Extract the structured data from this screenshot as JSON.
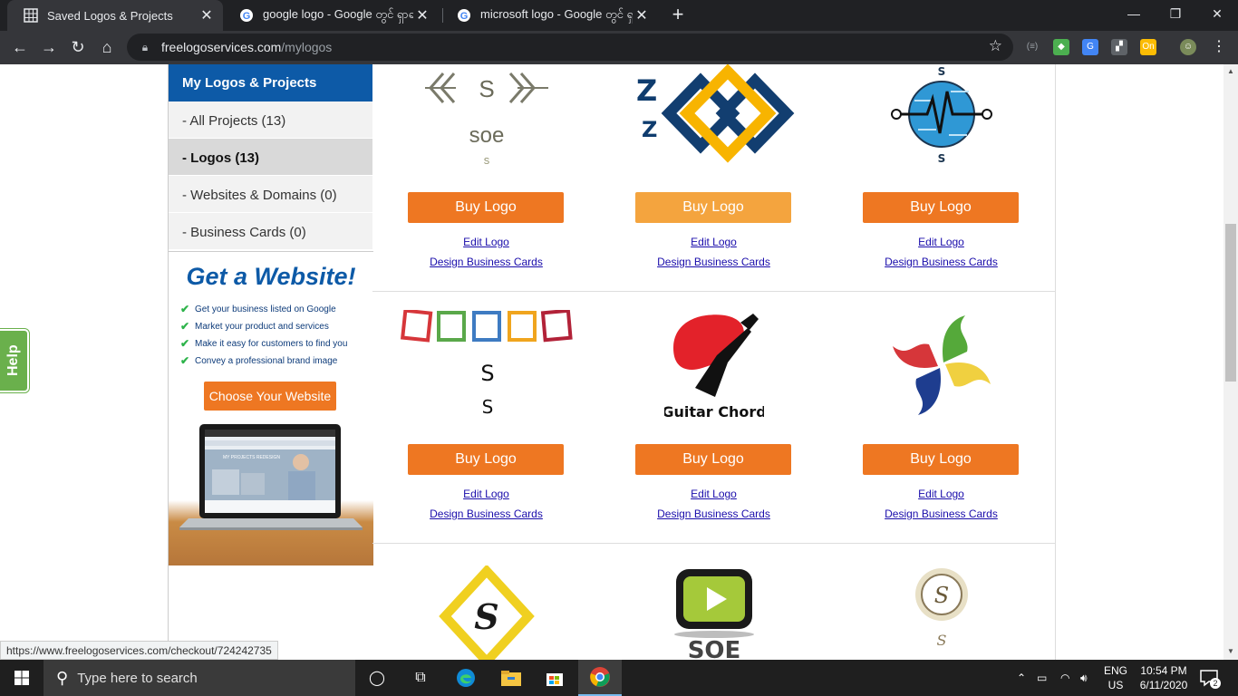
{
  "browser": {
    "tabs": [
      {
        "title": "Saved Logos & Projects",
        "active": true
      },
      {
        "title": "google logo - Google တွင် ရှာရန်",
        "active": false
      },
      {
        "title": "microsoft logo - Google တွင် ရှာရ",
        "active": false
      }
    ],
    "url_host": "freelogoservices.com",
    "url_path": "/mylogos",
    "status_url": "https://www.freelogoservices.com/checkout/724242735"
  },
  "sidebar": {
    "header": "My Logos & Projects",
    "items": [
      {
        "label": "- All Projects (13)"
      },
      {
        "label": "- Logos (13)"
      },
      {
        "label": "- Websites & Domains (0)"
      },
      {
        "label": "- Business Cards (0)"
      }
    ],
    "promo": {
      "title": "Get a Website!",
      "bullets": [
        "Get your business listed on Google",
        "Market your product and services",
        "Make it easy for customers to find you",
        "Convey a professional brand image"
      ],
      "button": "Choose Your Website",
      "laptop_screen_text": "MY PROJECTS REDESIGN"
    }
  },
  "grid": {
    "buy_label": "Buy Logo",
    "edit_label": "Edit Logo",
    "cards_label": "Design Business Cards",
    "logos": [
      {
        "type": "hex-s",
        "text": "soe",
        "sub": "s"
      },
      {
        "type": "chain-diamonds"
      },
      {
        "type": "ekg-circle",
        "top": "S",
        "bottom": "S"
      },
      {
        "type": "polaroids",
        "text": "S",
        "sub": "S"
      },
      {
        "type": "guitar",
        "text": "Guitar Chord"
      },
      {
        "type": "pinwheel"
      },
      {
        "type": "diamond-s",
        "text": "S"
      },
      {
        "type": "tv-play",
        "text": "SOE"
      },
      {
        "type": "wreath-s",
        "text": "S"
      }
    ]
  },
  "help_label": "Help",
  "taskbar": {
    "search_placeholder": "Type here to search",
    "lang_top": "ENG",
    "lang_bottom": "US",
    "time": "10:54 PM",
    "date": "6/11/2020",
    "notifications": "2"
  },
  "colors": {
    "brand_blue": "#0d5aa7",
    "buy_orange": "#ee7722",
    "buy_hover": "#f4a43e",
    "check_green": "#2db34a"
  }
}
